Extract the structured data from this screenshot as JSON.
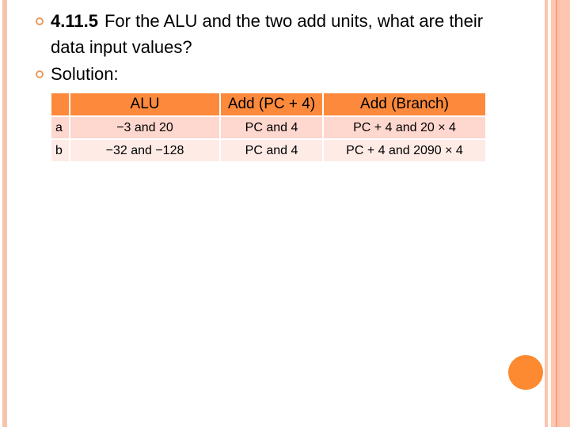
{
  "slide": {
    "bullets": [
      {
        "number": "4.11.5",
        "text": "For the ALU and the two add units, what are their data input values?"
      },
      {
        "text": "Solution:"
      }
    ],
    "table": {
      "headers": [
        "",
        "ALU",
        "Add (PC + 4)",
        "Add (Branch)"
      ],
      "rows": [
        {
          "label": "a",
          "alu": "−3 and 20",
          "add_pc4": "PC and 4",
          "add_branch": "PC + 4 and 20 × 4"
        },
        {
          "label": "b",
          "alu": "−32 and −128",
          "add_pc4": "PC and 4",
          "add_branch": "PC + 4 and 2090 × 4"
        }
      ]
    },
    "colors": {
      "accent": "#fd8a3c",
      "row_a": "#fed7ce",
      "row_b": "#feebe6",
      "bullet": "#e99a60"
    }
  }
}
